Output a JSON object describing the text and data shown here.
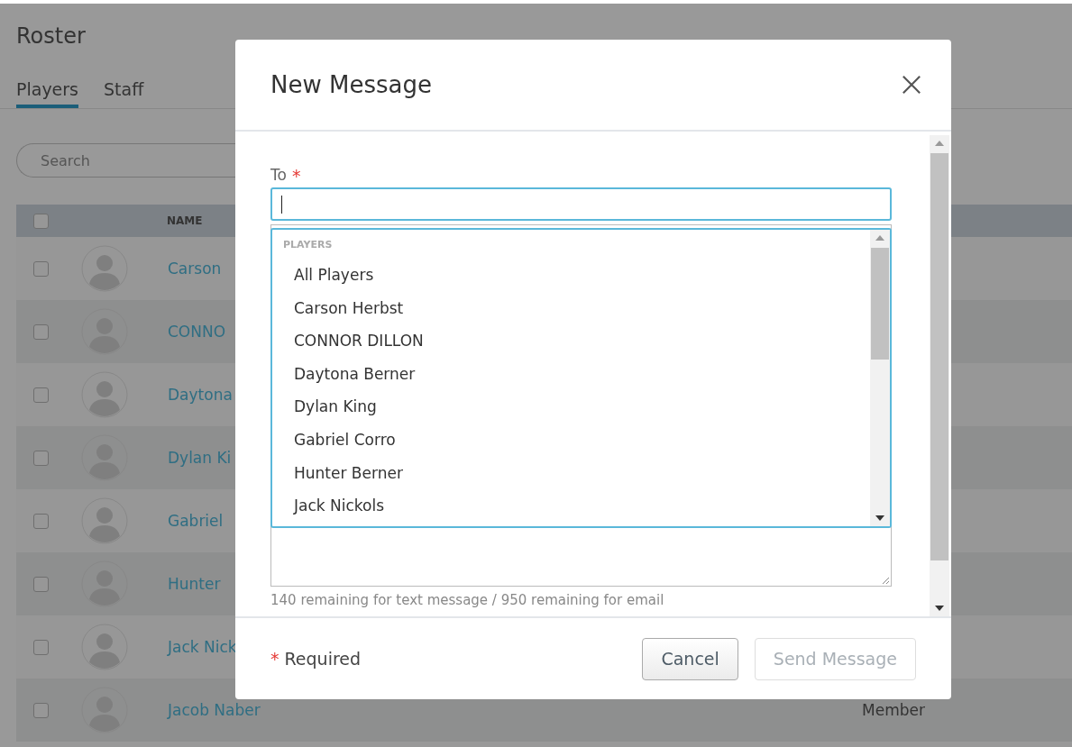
{
  "page": {
    "title": "Roster",
    "tabs": [
      {
        "label": "Players",
        "selected": true
      },
      {
        "label": "Staff",
        "selected": false
      }
    ],
    "search": {
      "placeholder": "Search"
    },
    "table": {
      "header_checked": false,
      "columns": [
        "NAME"
      ],
      "rows": [
        {
          "name": "Carson",
          "checked": false
        },
        {
          "name": "CONNO",
          "checked": false
        },
        {
          "name": "Daytona",
          "checked": false
        },
        {
          "name": "Dylan Ki",
          "checked": false
        },
        {
          "name": "Gabriel",
          "checked": false
        },
        {
          "name": "Hunter",
          "checked": false
        },
        {
          "name": "Jack Nick",
          "checked": false
        },
        {
          "name": "Jacob Naber",
          "checked": false,
          "column_3": "Member"
        }
      ]
    }
  },
  "dialog": {
    "title": "New Message",
    "to": {
      "label": "To",
      "required_mark": "*"
    },
    "dropdown": {
      "group": "PLAYERS",
      "items": [
        "All Players",
        "Carson Herbst",
        "CONNOR DILLON",
        "Daytona Berner",
        "Dylan King",
        "Gabriel Corro",
        "Hunter Berner",
        "Jack Nickols"
      ]
    },
    "counter": "140 remaining for text message / 950 remaining for email",
    "footer": {
      "required_mark": "*",
      "required_label": "Required",
      "buttons": [
        {
          "label": "Cancel",
          "disabled": false
        },
        {
          "label": "Send Message",
          "disabled": true
        }
      ]
    }
  }
}
